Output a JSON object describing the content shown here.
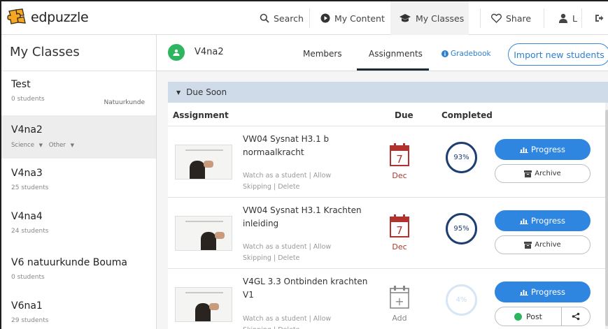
{
  "brand": {
    "name": "edpuzzle"
  },
  "nav": {
    "search": "Search",
    "my_content": "My Content",
    "my_classes": "My Classes",
    "share": "Share",
    "user": "L"
  },
  "sidebar": {
    "title": "My Classes",
    "classes": [
      {
        "name": "Test",
        "students": "0 students",
        "subject": "Natuurkunde"
      },
      {
        "name": "V4na2",
        "filter1": "Science",
        "filter2": "Other"
      },
      {
        "name": "V4na3",
        "students": "25 students"
      },
      {
        "name": "V4na4",
        "students": "24 students"
      },
      {
        "name": "V6 natuurkunde Bouma",
        "students": "0 students"
      },
      {
        "name": "V6na1",
        "students": "29 students"
      }
    ]
  },
  "class_header": {
    "name": "V4na2",
    "tabs": {
      "members": "Members",
      "assignments": "Assignments",
      "gradebook": "Gradebook"
    },
    "import_button": "Import new students"
  },
  "section": {
    "title": "Due Soon"
  },
  "table": {
    "headers": {
      "assignment": "Assignment",
      "due": "Due",
      "completed": "Completed"
    },
    "links": {
      "watch": "Watch as a student",
      "allow": "Allow",
      "skipping": "Skipping",
      "delete": "Delete"
    },
    "rows": [
      {
        "title": "VW04 Sysnat H3.1 b normaalkracht",
        "due_day": "7",
        "due_label": "Dec",
        "completed": "93%",
        "completed_value": 0.93,
        "primary_button": "Progress",
        "secondary_button": "Archive"
      },
      {
        "title": "VW04 Sysnat H3.1 Krachten inleiding",
        "due_day": "7",
        "due_label": "Dec",
        "completed": "95%",
        "completed_value": 0.95,
        "primary_button": "Progress",
        "secondary_button": "Archive"
      },
      {
        "title": "V4GL 3.3 Ontbinden krachten V1",
        "due_day": "+",
        "due_label": "Add",
        "completed": "4%",
        "completed_value": 0.04,
        "primary_button": "Progress",
        "secondary_button": "Post"
      }
    ]
  },
  "colors": {
    "accent": "#2f86e0",
    "due_red": "#b0332f",
    "navy": "#1e3e72",
    "brand_orange": "#f5a623",
    "brand_green": "#2db560"
  }
}
